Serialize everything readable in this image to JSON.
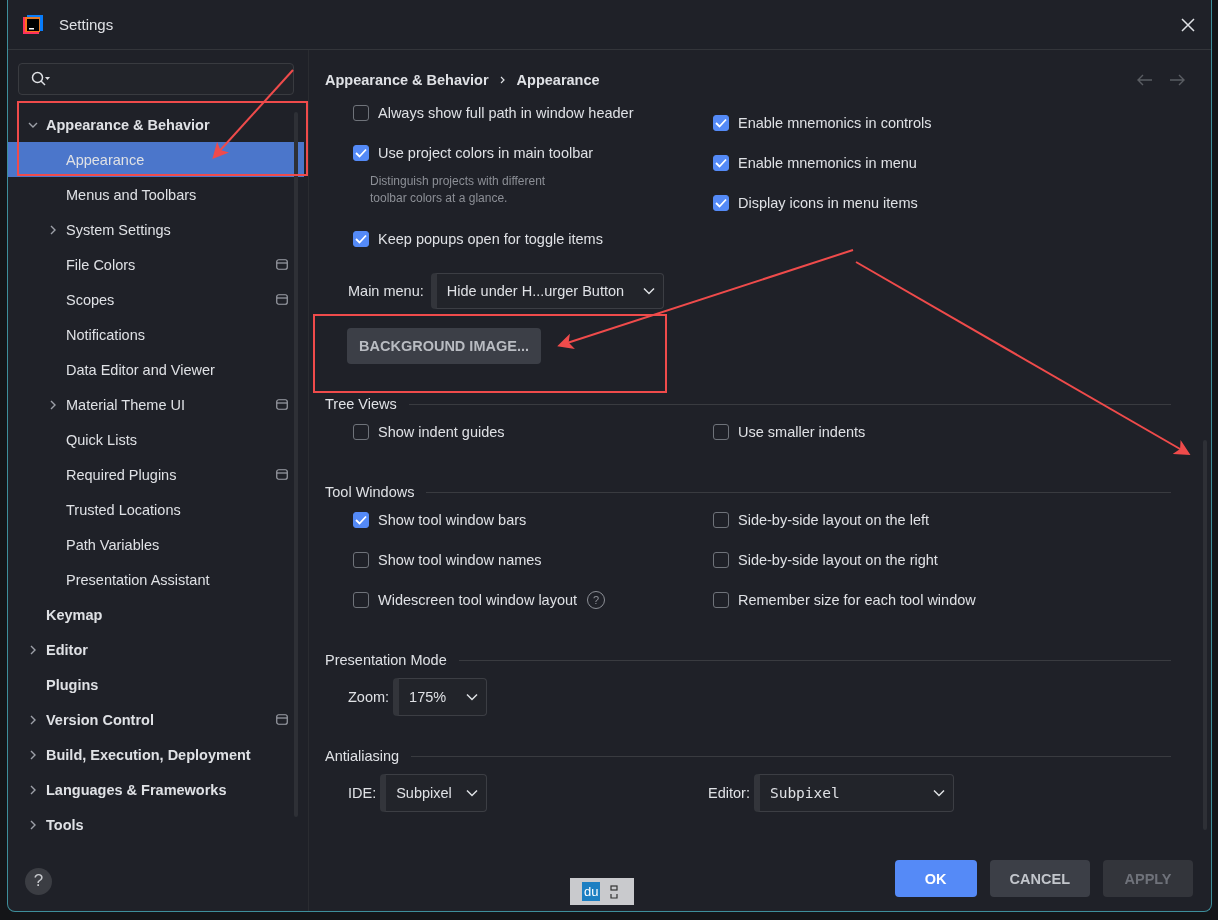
{
  "window": {
    "title": "Settings"
  },
  "sidebar": {
    "items": [
      {
        "label": "Appearance & Behavior",
        "kind": "folder",
        "expanded": true,
        "selected": false,
        "project_icon": false,
        "children": [
          {
            "label": "Appearance",
            "kind": "leaf",
            "selected": true,
            "project_icon": false
          },
          {
            "label": "Menus and Toolbars",
            "kind": "leaf",
            "selected": false,
            "project_icon": false
          },
          {
            "label": "System Settings",
            "kind": "folder",
            "expanded": false,
            "selected": false,
            "project_icon": false
          },
          {
            "label": "File Colors",
            "kind": "leaf",
            "selected": false,
            "project_icon": true
          },
          {
            "label": "Scopes",
            "kind": "leaf",
            "selected": false,
            "project_icon": true
          },
          {
            "label": "Notifications",
            "kind": "leaf",
            "selected": false,
            "project_icon": false
          },
          {
            "label": "Data Editor and Viewer",
            "kind": "leaf",
            "selected": false,
            "project_icon": false
          },
          {
            "label": "Material Theme UI",
            "kind": "folder",
            "expanded": false,
            "selected": false,
            "project_icon": true
          },
          {
            "label": "Quick Lists",
            "kind": "leaf",
            "selected": false,
            "project_icon": false
          },
          {
            "label": "Required Plugins",
            "kind": "leaf",
            "selected": false,
            "project_icon": true
          },
          {
            "label": "Trusted Locations",
            "kind": "leaf",
            "selected": false,
            "project_icon": false
          },
          {
            "label": "Path Variables",
            "kind": "leaf",
            "selected": false,
            "project_icon": false
          },
          {
            "label": "Presentation Assistant",
            "kind": "leaf",
            "selected": false,
            "project_icon": false
          }
        ]
      },
      {
        "label": "Keymap",
        "kind": "leaf",
        "selected": false,
        "project_icon": false
      },
      {
        "label": "Editor",
        "kind": "folder",
        "expanded": false,
        "selected": false,
        "project_icon": false
      },
      {
        "label": "Plugins",
        "kind": "leaf",
        "selected": false,
        "project_icon": false
      },
      {
        "label": "Version Control",
        "kind": "folder",
        "expanded": false,
        "selected": false,
        "project_icon": true
      },
      {
        "label": "Build, Execution, Deployment",
        "kind": "folder",
        "expanded": false,
        "selected": false,
        "project_icon": false
      },
      {
        "label": "Languages & Frameworks",
        "kind": "folder",
        "expanded": false,
        "selected": false,
        "project_icon": false
      },
      {
        "label": "Tools",
        "kind": "folder",
        "expanded": false,
        "selected": false,
        "project_icon": false
      }
    ]
  },
  "breadcrumb": [
    "Appearance & Behavior",
    "Appearance"
  ],
  "top_options": {
    "left": [
      {
        "label": "Always show full path in window header",
        "checked": false
      },
      {
        "label": "Use project colors in main toolbar",
        "checked": true,
        "hint": "Distinguish projects with different toolbar colors at a glance."
      },
      {
        "label": "Keep popups open for toggle items",
        "checked": true
      }
    ],
    "right": [
      {
        "label": "Enable mnemonics in controls",
        "checked": true
      },
      {
        "label": "Enable mnemonics in menu",
        "checked": true
      },
      {
        "label": "Display icons in menu items",
        "checked": true
      }
    ]
  },
  "main_menu": {
    "label": "Main menu:",
    "value": "Hide under H...urger Button"
  },
  "background_button": "BACKGROUND IMAGE...",
  "sections": [
    {
      "title": "Tree Views",
      "kind": "checkboxes",
      "left": [
        {
          "label": "Show indent guides",
          "checked": false
        }
      ],
      "right": [
        {
          "label": "Use smaller indents",
          "checked": false
        }
      ]
    },
    {
      "title": "Tool Windows",
      "kind": "checkboxes",
      "left": [
        {
          "label": "Show tool window bars",
          "checked": true
        },
        {
          "label": "Show tool window names",
          "checked": false
        },
        {
          "label": "Widescreen tool window layout",
          "checked": false,
          "help": "?"
        }
      ],
      "right": [
        {
          "label": "Side-by-side layout on the left",
          "checked": false
        },
        {
          "label": "Side-by-side layout on the right",
          "checked": false
        },
        {
          "label": "Remember size for each tool window",
          "checked": false
        }
      ]
    },
    {
      "title": "Presentation Mode",
      "kind": "dropdowns",
      "fields": [
        {
          "label": "Zoom:",
          "value": "175%",
          "mono": false
        }
      ]
    },
    {
      "title": "Antialiasing",
      "kind": "dropdowns",
      "fields": [
        {
          "label": "IDE:",
          "value": "Subpixel",
          "mono": false
        },
        {
          "label": "Editor:",
          "value": "Subpixel",
          "mono": true
        }
      ]
    }
  ],
  "buttons": [
    {
      "label": "OK",
      "kind": "primary"
    },
    {
      "label": "CANCEL",
      "kind": "normal"
    },
    {
      "label": "APPLY",
      "kind": "disabled"
    }
  ],
  "help_button": "?",
  "ime_toolbar": {
    "label": "du"
  }
}
